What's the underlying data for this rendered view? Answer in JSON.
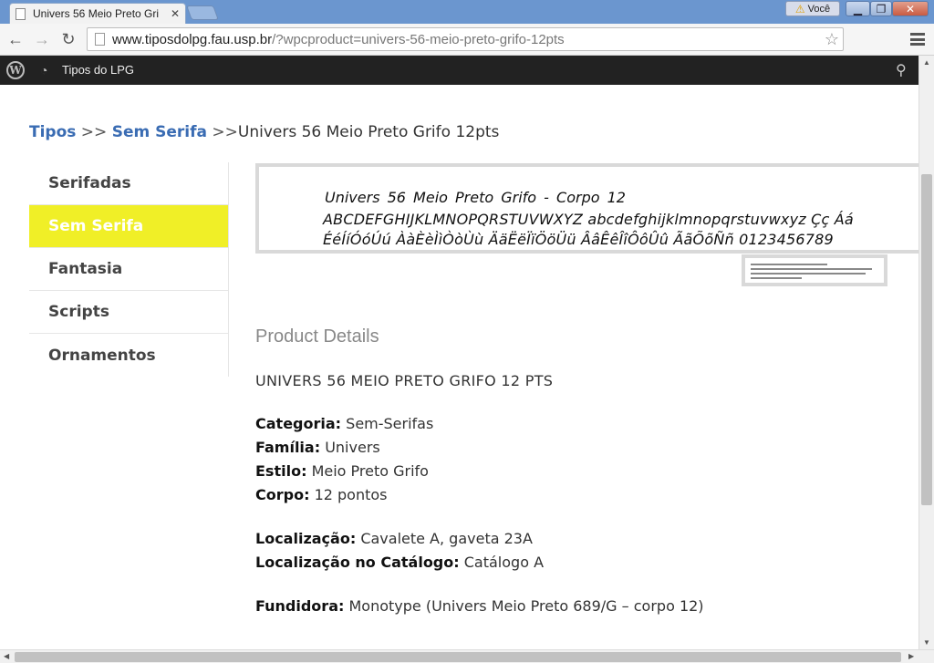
{
  "browser": {
    "tab_title": "Univers 56 Meio Preto Gri",
    "user_label": "Você",
    "url_host": "www.tiposdolpg.fau.usp.br",
    "url_path": "/?wpcproduct=univers-56-meio-preto-grifo-12pts"
  },
  "adminbar": {
    "site_name": "Tipos do LPG"
  },
  "breadcrumb": {
    "level1": "Tipos",
    "sep1": ">>",
    "level2": "Sem Serifa",
    "sep2": ">>",
    "current": "Univers 56 Meio Preto Grifo 12pts"
  },
  "sidebar": {
    "items": [
      {
        "label": "Serifadas",
        "active": false
      },
      {
        "label": "Sem Serifa",
        "active": true
      },
      {
        "label": "Fantasia",
        "active": false
      },
      {
        "label": "Scripts",
        "active": false
      },
      {
        "label": "Ornamentos",
        "active": false
      }
    ]
  },
  "preview": {
    "line1": "Univers 56 Meio Preto Grifo - Corpo 12",
    "line2": "ABCDEFGHIJKLMNOPQRSTUVWXYZ abcdefghijklmnopqrstuvwxyz Çç Áá",
    "line3": "ÉéÍíÓóÚú ÀàÈèÌìÒòÙù ÄäËëÏïÖöÜü ÂâÊêÎîÔôÛû ÃãÕõÑñ 0123456789"
  },
  "details": {
    "heading": "Product Details",
    "product_name": "UNIVERS 56 MEIO PRETO GRIFO 12 PTS",
    "categoria_label": "Categoria:",
    "categoria_value": "Sem-Serifas",
    "familia_label": "Família:",
    "familia_value": "Univers",
    "estilo_label": "Estilo:",
    "estilo_value": "Meio Preto Grifo",
    "corpo_label": "Corpo:",
    "corpo_value": "12 pontos",
    "localizacao_label": "Localização:",
    "localizacao_value": "Cavalete A, gaveta 23A",
    "catalogo_label": "Localização no Catálogo:",
    "catalogo_value": "Catálogo A",
    "fundidora_label": "Fundidora:",
    "fundidora_value": "Monotype (Univers Meio Preto 689/G – corpo 12)"
  }
}
